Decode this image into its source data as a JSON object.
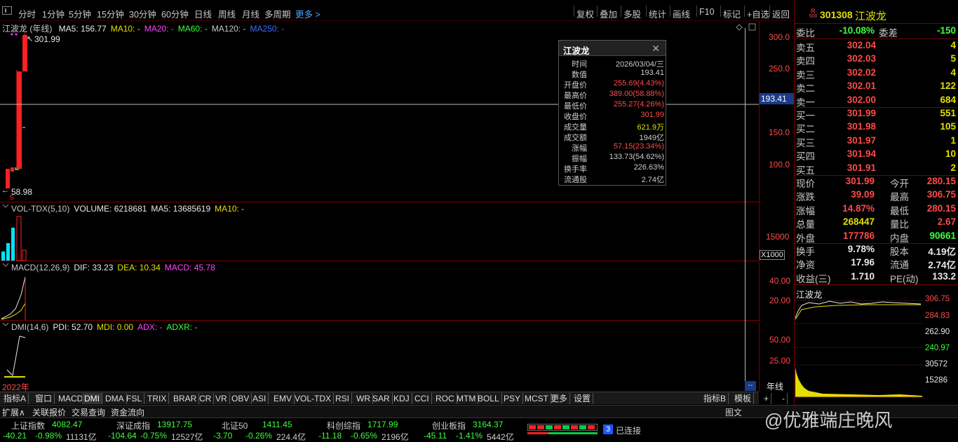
{
  "toolbar": {
    "periods": [
      "分时",
      "1分钟",
      "5分钟",
      "15分钟",
      "30分钟",
      "60分钟",
      "日线",
      "周线",
      "月线",
      "多周期",
      "更多 >"
    ],
    "tools": [
      "复权",
      "叠加",
      "多股",
      "统计",
      "画线",
      "F10",
      "标记",
      "+自选",
      "返回"
    ]
  },
  "main_panel": {
    "name": "江波龙 (年线)",
    "ma": [
      {
        "label": "MA5: 156.77",
        "color": "#e8e8e8"
      },
      {
        "label": "MA10: -",
        "color": "#e0e000"
      },
      {
        "label": "MA20: -",
        "color": "#ff44ff"
      },
      {
        "label": "MA60: -",
        "color": "#3cff3c"
      },
      {
        "label": "MA120: -",
        "color": "#c8c8c8"
      },
      {
        "label": "MA250: -",
        "color": "#3c6cff"
      }
    ],
    "high_label": "301.99",
    "low_label": "58.98",
    "y_ticks": [
      "300.0",
      "250.0",
      "150.0",
      "100.0"
    ],
    "crosshair_value": "193.41"
  },
  "volume_panel": {
    "header": [
      {
        "label": "VOL-TDX(5,10)",
        "color": "#c8c8c8"
      },
      {
        "label": "VOLUME: 6218681",
        "color": "#e8e8e8"
      },
      {
        "label": "MA5: 13685619",
        "color": "#e8e8e8"
      },
      {
        "label": "MA10: -",
        "color": "#e0e000"
      }
    ],
    "y_tick": "15000",
    "unit": "X1000"
  },
  "macd_panel": {
    "header": [
      {
        "label": "MACD(12,26,9)",
        "color": "#c8c8c8"
      },
      {
        "label": "DIF: 33.23",
        "color": "#e8e8e8"
      },
      {
        "label": "DEA: 10.34",
        "color": "#e0e000"
      },
      {
        "label": "MACD: 45.78",
        "color": "#ff44ff"
      }
    ],
    "y_ticks": [
      "40.00",
      "20.00"
    ]
  },
  "dmi_panel": {
    "header": [
      {
        "label": "DMI(14,6)",
        "color": "#c8c8c8"
      },
      {
        "label": "PDI: 52.70",
        "color": "#e8e8e8"
      },
      {
        "label": "MDI: 0.00",
        "color": "#e0e000"
      },
      {
        "label": "ADX: -",
        "color": "#ff44ff"
      },
      {
        "label": "ADXR: -",
        "color": "#3cff3c"
      }
    ],
    "y_ticks": [
      "50.00",
      "25.00"
    ],
    "year_label": "2022年",
    "axis_label": "年线"
  },
  "tooltip": {
    "title": "江波龙",
    "rows": [
      {
        "k": "时间",
        "v": "2026/03/04/三",
        "c": "#ccc"
      },
      {
        "k": "数值",
        "v": "193.41",
        "c": "#ccc"
      },
      {
        "k": "开盘价",
        "v": "255.69(4.43%)",
        "c": "#ff4a4a"
      },
      {
        "k": "最高价",
        "v": "389.00(58.88%)",
        "c": "#ff4a4a"
      },
      {
        "k": "最低价",
        "v": "255.27(4.26%)",
        "c": "#ff4a4a"
      },
      {
        "k": "收盘价",
        "v": "301.99",
        "c": "#ff4a4a"
      },
      {
        "k": "成交量",
        "v": "621.9万",
        "c": "#e0e000"
      },
      {
        "k": "成交额",
        "v": "1949亿",
        "c": "#ccc"
      },
      {
        "k": "涨幅",
        "v": "57.15(23.34%)",
        "c": "#ff4a4a"
      },
      {
        "k": "振幅",
        "v": "133.73(54.62%)",
        "c": "#ccc"
      },
      {
        "k": "换手率",
        "v": "226.63%",
        "c": "#ccc"
      },
      {
        "k": "流通股",
        "v": "2.74亿",
        "c": "#ccc"
      }
    ]
  },
  "quote": {
    "badge_top": "R",
    "badge_bottom": "500",
    "code": "301308",
    "name": "江波龙",
    "weibi_label": "委比",
    "weibi_value": "-10.08%",
    "weicha_label": "委差",
    "weicha_value": "-150",
    "asks": [
      {
        "label": "卖五",
        "price": "302.04",
        "vol": "4"
      },
      {
        "label": "卖四",
        "price": "302.03",
        "vol": "5"
      },
      {
        "label": "卖三",
        "price": "302.02",
        "vol": "4"
      },
      {
        "label": "卖二",
        "price": "302.01",
        "vol": "122"
      },
      {
        "label": "卖一",
        "price": "302.00",
        "vol": "684"
      }
    ],
    "bids": [
      {
        "label": "买一",
        "price": "301.99",
        "vol": "551"
      },
      {
        "label": "买二",
        "price": "301.98",
        "vol": "105"
      },
      {
        "label": "买三",
        "price": "301.97",
        "vol": "1"
      },
      {
        "label": "买四",
        "price": "301.94",
        "vol": "10"
      },
      {
        "label": "买五",
        "price": "301.91",
        "vol": "2"
      }
    ],
    "stats": [
      {
        "l1": "现价",
        "v1": "301.99",
        "c1": "#ff4a4a",
        "l2": "今开",
        "v2": "280.15",
        "c2": "#ff4a4a"
      },
      {
        "l1": "涨跌",
        "v1": "39.09",
        "c1": "#ff4a4a",
        "l2": "最高",
        "v2": "306.75",
        "c2": "#ff4a4a"
      },
      {
        "l1": "涨幅",
        "v1": "14.87%",
        "c1": "#ff4a4a",
        "l2": "最低",
        "v2": "280.15",
        "c2": "#ff4a4a"
      },
      {
        "l1": "总量",
        "v1": "268447",
        "c1": "#e0e000",
        "l2": "量比",
        "v2": "2.67",
        "c2": "#ff4a4a"
      },
      {
        "l1": "外盘",
        "v1": "177786",
        "c1": "#ff4a4a",
        "l2": "内盘",
        "v2": "90661",
        "c2": "#3cff3c"
      }
    ],
    "stats2": [
      {
        "l1": "换手",
        "v1": "9.78%",
        "c1": "#e8e8e8",
        "l2": "股本",
        "v2": "4.19亿",
        "c2": "#e8e8e8"
      },
      {
        "l1": "净资",
        "v1": "17.96",
        "c1": "#e8e8e8",
        "l2": "流通",
        "v2": "2.74亿",
        "c2": "#e8e8e8"
      },
      {
        "l1": "收益(三)",
        "v1": "1.710",
        "c1": "#e8e8e8",
        "l2": "PE(动)",
        "v2": "133.2",
        "c2": "#e8e8e8"
      }
    ],
    "mini_title": "江波龙",
    "mini_ticks": [
      "306.75",
      "284.83",
      "262.90",
      "240.97",
      "30572",
      "15286"
    ]
  },
  "tabs_left": [
    "指标A",
    "窗口",
    "MACD",
    "DMI",
    "DMA",
    "FSL",
    "TRIX",
    "BRAR",
    "CR",
    "VR",
    "OBV",
    "ASI",
    "EMV",
    "VOL-TDX",
    "RSI",
    "WR",
    "SAR",
    "KDJ",
    "CCI",
    "ROC",
    "MTM",
    "BOLL",
    "PSY",
    "MCST",
    "更多",
    "设置"
  ],
  "tabs_right": [
    "指标B",
    "模板",
    "+",
    "-"
  ],
  "bottom_tabs": [
    "扩展∧",
    "关联报价",
    "交易查询",
    "资金流向"
  ],
  "bottom_right": [
    "图文",
    "优雅端庄晚风"
  ],
  "ticker": [
    {
      "name": "上证指数",
      "value": "4082.47",
      "chg": "-40.21",
      "pct": "-0.98%",
      "amt": "11131亿"
    },
    {
      "name": "深证成指",
      "value": "13917.75",
      "chg": "-104.64",
      "pct": "-0.75%",
      "amt": "12527亿"
    },
    {
      "name": "北证50",
      "value": "1411.45",
      "chg": "-3.70",
      "pct": "-0.26%",
      "amt": "224.4亿"
    },
    {
      "name": "科创综指",
      "value": "1717.99",
      "chg": "-11.18",
      "pct": "-0.65%",
      "amt": "2196亿"
    },
    {
      "name": "创业板指",
      "value": "3164.37",
      "chg": "-45.11",
      "pct": "-1.41%",
      "amt": "5442亿"
    }
  ],
  "connect": {
    "num": "3",
    "label": "已连接"
  },
  "watermark": "@优雅端庄晚风"
}
